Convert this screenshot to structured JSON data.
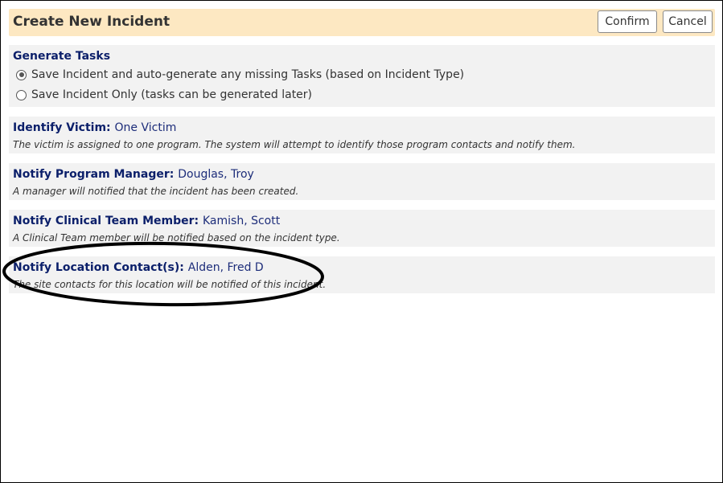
{
  "dialog": {
    "title": "Create New Incident",
    "confirm_label": "Confirm",
    "cancel_label": "Cancel"
  },
  "generate_tasks": {
    "heading": "Generate Tasks",
    "options": [
      {
        "label": "Save Incident and auto-generate any missing Tasks (based on Incident Type)",
        "selected": true
      },
      {
        "label": "Save Incident Only (tasks can be generated later)",
        "selected": false
      }
    ]
  },
  "sections": {
    "victim": {
      "label": "Identify Victim:",
      "value": "One Victim",
      "description": "The victim is assigned to one program. The system will attempt to identify those program contacts and notify them."
    },
    "program_manager": {
      "label": "Notify Program Manager:",
      "value": "Douglas, Troy",
      "description": "A manager will notified that the incident has been created."
    },
    "clinical_team": {
      "label": "Notify Clinical Team Member:",
      "value": "Kamish, Scott",
      "description": "A Clinical Team member will be notified based on the incident type."
    },
    "location_contacts": {
      "label": "Notify Location Contact(s):",
      "value": "Alden, Fred D",
      "description": "The site contacts for this location will be notified of this incident."
    }
  },
  "colors": {
    "header_bg": "#fde8c2",
    "panel_bg": "#f2f2f2",
    "label_color": "#0b1f6a",
    "annotation_stroke": "#000000"
  }
}
